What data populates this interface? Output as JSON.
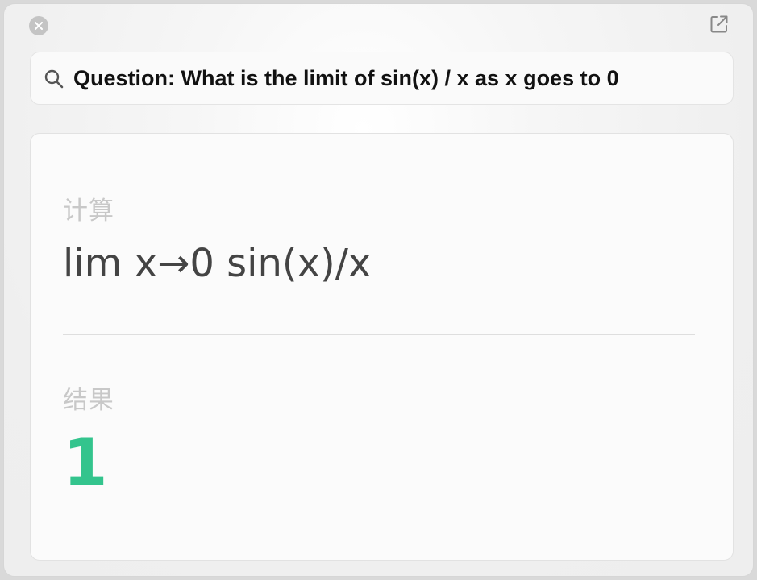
{
  "window": {
    "close_icon": "close-icon",
    "open_external_icon": "open-external-icon"
  },
  "search": {
    "icon": "search-icon",
    "value": "Question: What is the limit of sin(x) / x as x goes to 0"
  },
  "result_card": {
    "compute_label": "计算",
    "expression": "lim x→0 sin(x)/x",
    "result_label": "结果",
    "result_value": "1"
  },
  "colors": {
    "result_accent": "#33c48d",
    "label_gray": "#c8c8c8",
    "expression_text": "#444444"
  }
}
